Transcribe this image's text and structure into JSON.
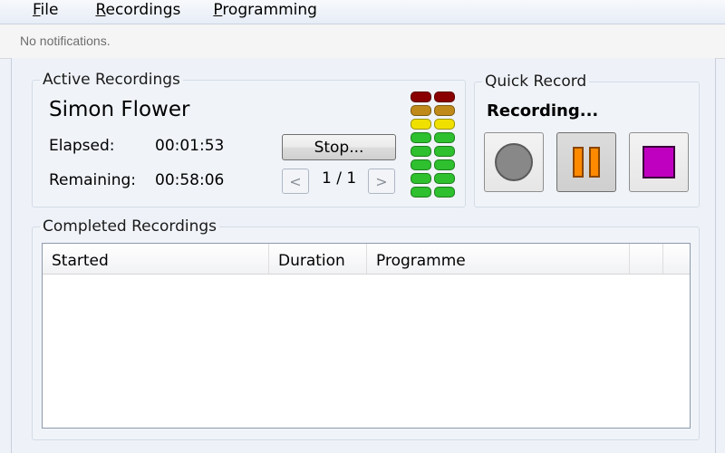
{
  "menu": {
    "items": [
      {
        "accel": "F",
        "rest": "ile"
      },
      {
        "accel": "R",
        "rest": "ecordings"
      },
      {
        "accel": "P",
        "rest": "rogramming"
      }
    ]
  },
  "notification": "No notifications.",
  "active": {
    "legend": "Active Recordings",
    "name": "Simon Flower",
    "elapsed_label": "Elapsed:",
    "elapsed": "00:01:53",
    "remaining_label": "Remaining:",
    "remaining": "00:58:06",
    "stop_label": "Stop...",
    "prev_icon": "chevron-left-icon",
    "next_icon": "chevron-right-icon",
    "prev_glyph": "<",
    "next_glyph": ">",
    "pager": "1 / 1",
    "level_meter": {
      "segments_per_channel": 8,
      "lit_segments": 8,
      "colors": [
        "#8a0000",
        "#8a0000",
        "#d4a017",
        "#f0e000",
        "#2ec02e",
        "#2ec02e",
        "#2ec02e",
        "#2ec02e",
        "#2ec02e",
        "#2ec02e",
        "#2ec02e"
      ]
    }
  },
  "quick": {
    "legend": "Quick Record",
    "status": "Recording...",
    "record_icon": "record-icon",
    "pause_icon": "pause-icon",
    "stop_icon": "stop-icon",
    "record_color": "#888888",
    "pause_color": "#ff8a00",
    "stop_color": "#c000c0"
  },
  "completed": {
    "legend": "Completed Recordings",
    "columns": [
      "Started",
      "Duration",
      "Programme"
    ],
    "rows": []
  }
}
